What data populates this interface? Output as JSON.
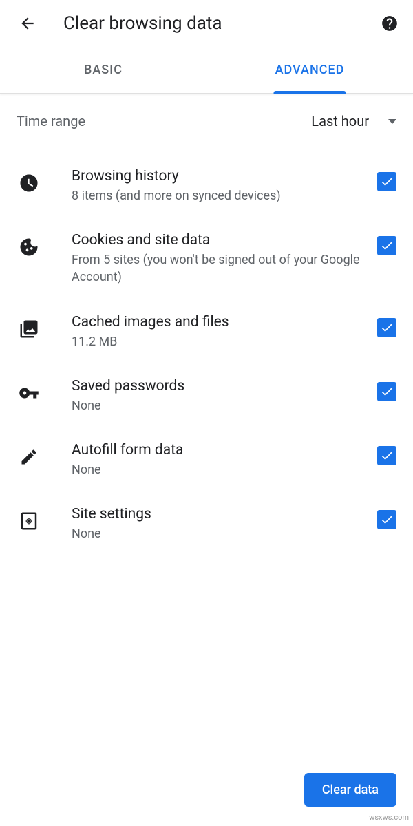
{
  "header": {
    "title": "Clear browsing data"
  },
  "tabs": {
    "basic": "BASIC",
    "advanced": "ADVANCED"
  },
  "time_range": {
    "label": "Time range",
    "value": "Last hour"
  },
  "items": [
    {
      "title": "Browsing history",
      "subtitle": "8 items (and more on synced devices)",
      "checked": true
    },
    {
      "title": "Cookies and site data",
      "subtitle": "From 5 sites (you won't be signed out of your Google Account)",
      "checked": true
    },
    {
      "title": "Cached images and files",
      "subtitle": "11.2 MB",
      "checked": true
    },
    {
      "title": "Saved passwords",
      "subtitle": "None",
      "checked": true
    },
    {
      "title": "Autofill form data",
      "subtitle": "None",
      "checked": true
    },
    {
      "title": "Site settings",
      "subtitle": "None",
      "checked": true
    }
  ],
  "footer": {
    "clear_button": "Clear data"
  },
  "watermark": "wsxws.com",
  "colors": {
    "accent": "#1a73e8",
    "text_primary": "#202124",
    "text_secondary": "#5f6368"
  }
}
